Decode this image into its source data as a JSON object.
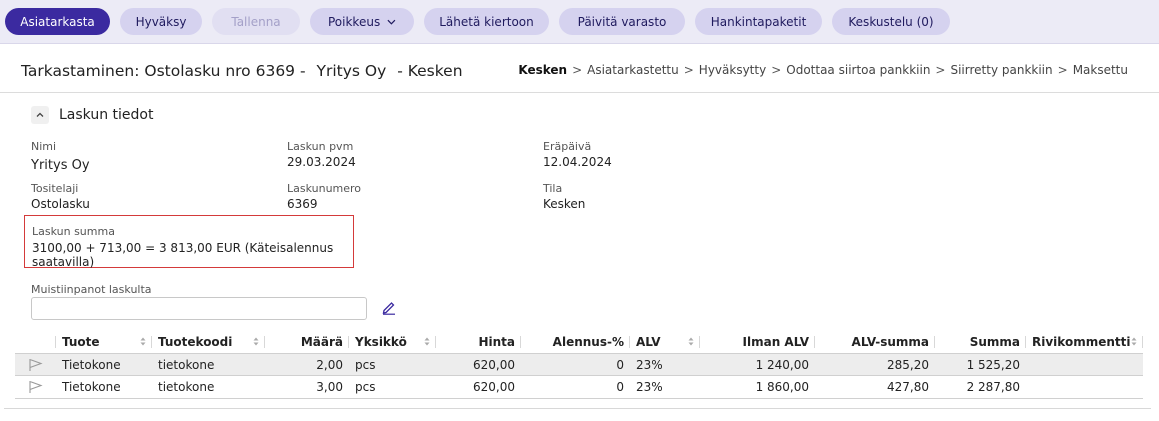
{
  "toolbar": {
    "buttons": [
      {
        "label": "Asiatarkasta"
      },
      {
        "label": "Hyväksy"
      },
      {
        "label": "Tallenna"
      },
      {
        "label": "Poikkeus"
      },
      {
        "label": "Lähetä kiertoon"
      },
      {
        "label": "Päivitä varasto"
      },
      {
        "label": "Hankintapaketit"
      },
      {
        "label": "Keskustelu (0)"
      }
    ]
  },
  "header": {
    "title_prefix": "Tarkastaminen: Ostolasku nro 6369 -",
    "title_company": "Yritys Oy",
    "title_status": "- Kesken",
    "breadcrumb": [
      "Kesken",
      "Asiatarkastettu",
      "Hyväksytty",
      "Odottaa siirtoa pankkiin",
      "Siirretty pankkiin",
      "Maksettu"
    ],
    "breadcrumb_sep": ">"
  },
  "section": {
    "title": "Laskun tiedot"
  },
  "fields": {
    "nimi": {
      "label": "Nimi",
      "value": "Yritys Oy"
    },
    "laskun_pvm": {
      "label": "Laskun pvm",
      "value": "29.03.2024"
    },
    "erapaiva": {
      "label": "Eräpäivä",
      "value": "12.04.2024"
    },
    "tositelaji": {
      "label": "Tositelaji",
      "value": "Ostolasku"
    },
    "laskunumero": {
      "label": "Laskunumero",
      "value": "6369"
    },
    "tila": {
      "label": "Tila",
      "value": "Kesken"
    },
    "laskun_summa": {
      "label": "Laskun summa",
      "value": "3100,00 + 713,00 = 3 813,00 EUR (Käteisalennus saatavilla)"
    }
  },
  "notes": {
    "label": "Muistiinpanot laskulta",
    "value": ""
  },
  "table": {
    "columns": [
      "Tuote",
      "Tuotekoodi",
      "Määrä",
      "Yksikkö",
      "Hinta",
      "Alennus-%",
      "ALV",
      "Ilman ALV",
      "ALV-summa",
      "Summa",
      "Rivikommentti"
    ],
    "rows": [
      {
        "tuote": "Tietokone",
        "tuotekoodi": "tietokone",
        "maara": "2,00",
        "yksikko": "pcs",
        "hinta": "620,00",
        "alennus": "0",
        "alv": "23%",
        "ilman_alv": "1 240,00",
        "alv_summa": "285,20",
        "summa": "1 525,20",
        "rivikommentti": ""
      },
      {
        "tuote": "Tietokone",
        "tuotekoodi": "tietokone",
        "maara": "3,00",
        "yksikko": "pcs",
        "hinta": "620,00",
        "alennus": "0",
        "alv": "23%",
        "ilman_alv": "1 860,00",
        "alv_summa": "427,80",
        "summa": "2 287,80",
        "rivikommentti": ""
      }
    ]
  },
  "colors": {
    "primary": "#3b2aa0",
    "button_bg": "#d5d2ef",
    "toolbar_bg": "#ecebf6",
    "highlight_border": "#d43a3a"
  },
  "icons": {
    "collapse": "chevron-up-icon",
    "edit": "pencil-icon",
    "row_flag": "flag-icon",
    "sort": "sort-icon",
    "dropdown": "chevron-down-icon"
  }
}
